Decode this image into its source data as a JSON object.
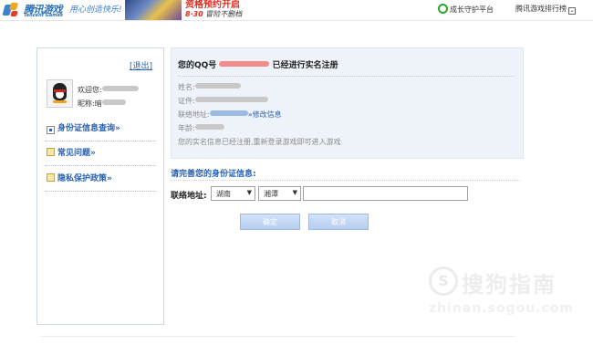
{
  "header": {
    "logo_cn": "腾讯游戏",
    "logo_en": "Tencent Games",
    "slogan": "用心创造快乐!",
    "promo_line1": "资格预约开启",
    "promo_date": "8·30",
    "promo_line2": "冒险不删档",
    "guardian": "成长守护平台",
    "rank": "腾讯游戏排行榜"
  },
  "sidebar": {
    "logout": "[退出]",
    "welcome_label": "欢迎您:",
    "nickname_label": "昵称:",
    "nickname_prefix": "暗",
    "items": [
      {
        "label": "身份证信息查询»",
        "icon": "id-card-icon"
      },
      {
        "label": "常见问题»",
        "icon": "pencil-icon"
      },
      {
        "label": "隐私保护政策»",
        "icon": "pencil-icon"
      }
    ]
  },
  "info": {
    "title_prefix": "您的QQ号",
    "title_suffix": "已经进行实名注册",
    "name_label": "姓名:",
    "id_label": "证件:",
    "address_label": "联络地址:",
    "modify_link": "»修改信息",
    "age_label": "年龄:",
    "note": "您的实名信息已经注册,重新登录游戏即可进入游戏"
  },
  "form": {
    "title": "请完善您的身份证信息:",
    "address_label": "联络地址:",
    "province": "湖南",
    "city": "湘潭",
    "address_value": "",
    "confirm": "确定",
    "cancel": "取消"
  },
  "watermark": {
    "cn": "搜狗指南",
    "url": "zhinan.sogou.com",
    "icon": "sogou-s-icon"
  },
  "colors": {
    "link": "#2a61b1",
    "info_bg": "#eef3fa",
    "panel_border": "#c9d9ea",
    "button": "#b4cdf0",
    "promo_red": "#e02b20"
  }
}
